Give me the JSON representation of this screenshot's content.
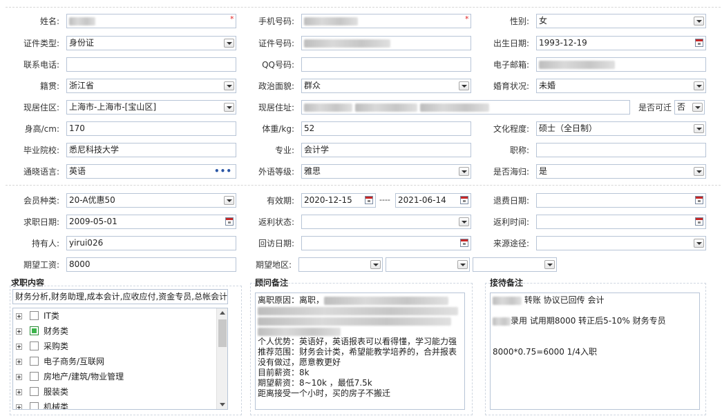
{
  "personal": {
    "name": {
      "label": "姓名:",
      "value": ""
    },
    "phone": {
      "label": "手机号码:",
      "value": ""
    },
    "gender": {
      "label": "性别:",
      "value": "女"
    },
    "id_type": {
      "label": "证件类型:",
      "value": "身份证"
    },
    "id_number": {
      "label": "证件号码:",
      "value": ""
    },
    "birth_date": {
      "label": "出生日期:",
      "value": "1993-12-19"
    },
    "contact_phone": {
      "label": "联系电话:",
      "value": ""
    },
    "qq": {
      "label": "QQ号码:",
      "value": ""
    },
    "email": {
      "label": "电子邮箱:",
      "value": ""
    },
    "native_place": {
      "label": "籍贯:",
      "value": "浙江省"
    },
    "political_status": {
      "label": "政治面貌:",
      "value": "群众"
    },
    "marital_status": {
      "label": "婚育状况:",
      "value": "未婚"
    },
    "current_area": {
      "label": "现居住区:",
      "value": "上海市-上海市-[宝山区]"
    },
    "current_address": {
      "label": "现居住址:",
      "value": ""
    },
    "relocate": {
      "label": "是否可迁",
      "value": "否"
    },
    "height": {
      "label": "身高/cm:",
      "value": "170"
    },
    "weight": {
      "label": "体重/kg:",
      "value": "52"
    },
    "education": {
      "label": "文化程度:",
      "value": "硕士（全日制）"
    },
    "school": {
      "label": "毕业院校:",
      "value": "悉尼科技大学"
    },
    "major": {
      "label": "专业:",
      "value": "会计学"
    },
    "title": {
      "label": "职称:",
      "value": ""
    },
    "language": {
      "label": "通晓语言:",
      "value": "英语",
      "more": "•••"
    },
    "language_level": {
      "label": "外语等级:",
      "value": "雅思"
    },
    "returnee": {
      "label": "是否海归:",
      "value": "是"
    }
  },
  "membership": {
    "member_type": {
      "label": "会员种类:",
      "value": "20-A优惠50"
    },
    "valid_period": {
      "label": "有效期:",
      "start": "2020-12-15",
      "separator": "----",
      "end": "2021-06-14"
    },
    "refund_date": {
      "label": "退费日期:",
      "value": ""
    },
    "job_seek_date": {
      "label": "求职日期:",
      "value": "2009-05-01"
    },
    "rebate_status": {
      "label": "返利状态:",
      "value": ""
    },
    "rebate_time": {
      "label": "返利时间:",
      "value": ""
    },
    "holder": {
      "label": "持有人:",
      "value": "yirui026"
    },
    "revisit_date": {
      "label": "回访日期:",
      "value": ""
    },
    "source_channel": {
      "label": "来源途径:",
      "value": ""
    },
    "expected_salary": {
      "label": "期望工资:",
      "value": "8000"
    },
    "expected_area": {
      "label": "期望地区:",
      "values": [
        "",
        "",
        ""
      ]
    }
  },
  "job_content": {
    "title": "求职内容",
    "summary": "财务分析,财务助理,成本会计,应收应付,资金专员,总帐会计",
    "categories": [
      {
        "label": "IT类",
        "checked": false
      },
      {
        "label": "财务类",
        "checked": true
      },
      {
        "label": "采购类",
        "checked": false
      },
      {
        "label": "电子商务/互联网",
        "checked": false
      },
      {
        "label": "房地产/建筑/物业管理",
        "checked": false
      },
      {
        "label": "服装类",
        "checked": false
      },
      {
        "label": "机械类",
        "checked": false
      }
    ]
  },
  "advisor_notes": {
    "title": "顾问备注",
    "lines": [
      "离职原因：离职，",
      "",
      "",
      "",
      "个人优势：英语好，英语报表可以看得懂，学习能力强",
      "推荐范围：财务会计类，希望能教学培养的，合并报表",
      "没有做过，愿意教更好",
      "目前薪资：8k",
      "期望薪资：8~10k ，最低7.5k",
      "距离接受一个小时，买的房子不搬迁"
    ]
  },
  "reception_notes": {
    "title": "接待备注",
    "lines": [
      "转账 协议已回传 会计",
      "",
      "录用  试用期8000  转正后5-10%  财务专员",
      "",
      "",
      "8000*0.75=6000  1/4入职"
    ]
  },
  "colors": {
    "field_border": "#b7c4d6",
    "required_mark": "#e02020",
    "checked_box": "#3cb44b",
    "dots": "#2a56a5"
  }
}
